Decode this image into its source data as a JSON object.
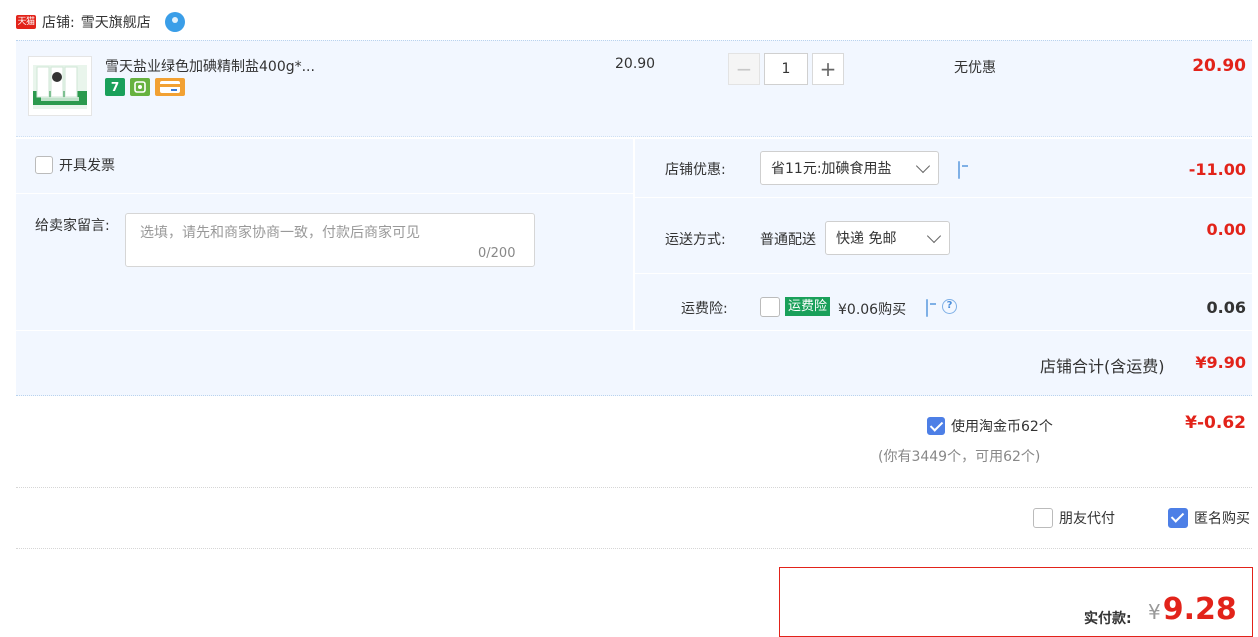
{
  "store": {
    "badge": "天猫",
    "label": "店铺:",
    "name": "雪天旗舰店"
  },
  "product": {
    "title": "雪天盐业绿色加碘精制盐400g*...",
    "service_icons": [
      "7",
      "guarantee-icon",
      "card-icon"
    ],
    "price": "20.90",
    "quantity": "1",
    "minus": "−",
    "plus": "+",
    "promo": "无优惠",
    "subtotal": "20.90"
  },
  "options": {
    "invoice_label": "开具发票",
    "message_label": "给卖家留言:",
    "message_placeholder": "选填，请先和商家协商一致，付款后商家可见",
    "message_count": "0/200",
    "shop_discount_label": "店铺优惠:",
    "shop_discount_value": "省11元:加碘食用盐",
    "shop_discount_amount": "-11.00",
    "shipping_label": "运送方式:",
    "shipping_type": "普通配送",
    "shipping_value": "快递 免邮",
    "shipping_amount": "0.00",
    "insurance_label": "运费险:",
    "insurance_tag": "运费险",
    "insurance_price": "¥0.06购买",
    "insurance_amount": "0.06"
  },
  "total": {
    "label": "店铺合计(含运费)",
    "value": "¥9.90"
  },
  "coins": {
    "label": "使用淘金币62个",
    "sub": "(你有3449个，可用62个)",
    "value": "¥-0.62"
  },
  "extras": {
    "friend_pay": "朋友代付",
    "anonymous": "匿名购买"
  },
  "pay": {
    "label": "实付款:",
    "yen": "¥",
    "amount": "9.28"
  },
  "colors": {
    "accent_red": "#e2231a",
    "panel_bg": "#f2f7ff",
    "checkbox_blue": "#4d7fe6"
  }
}
